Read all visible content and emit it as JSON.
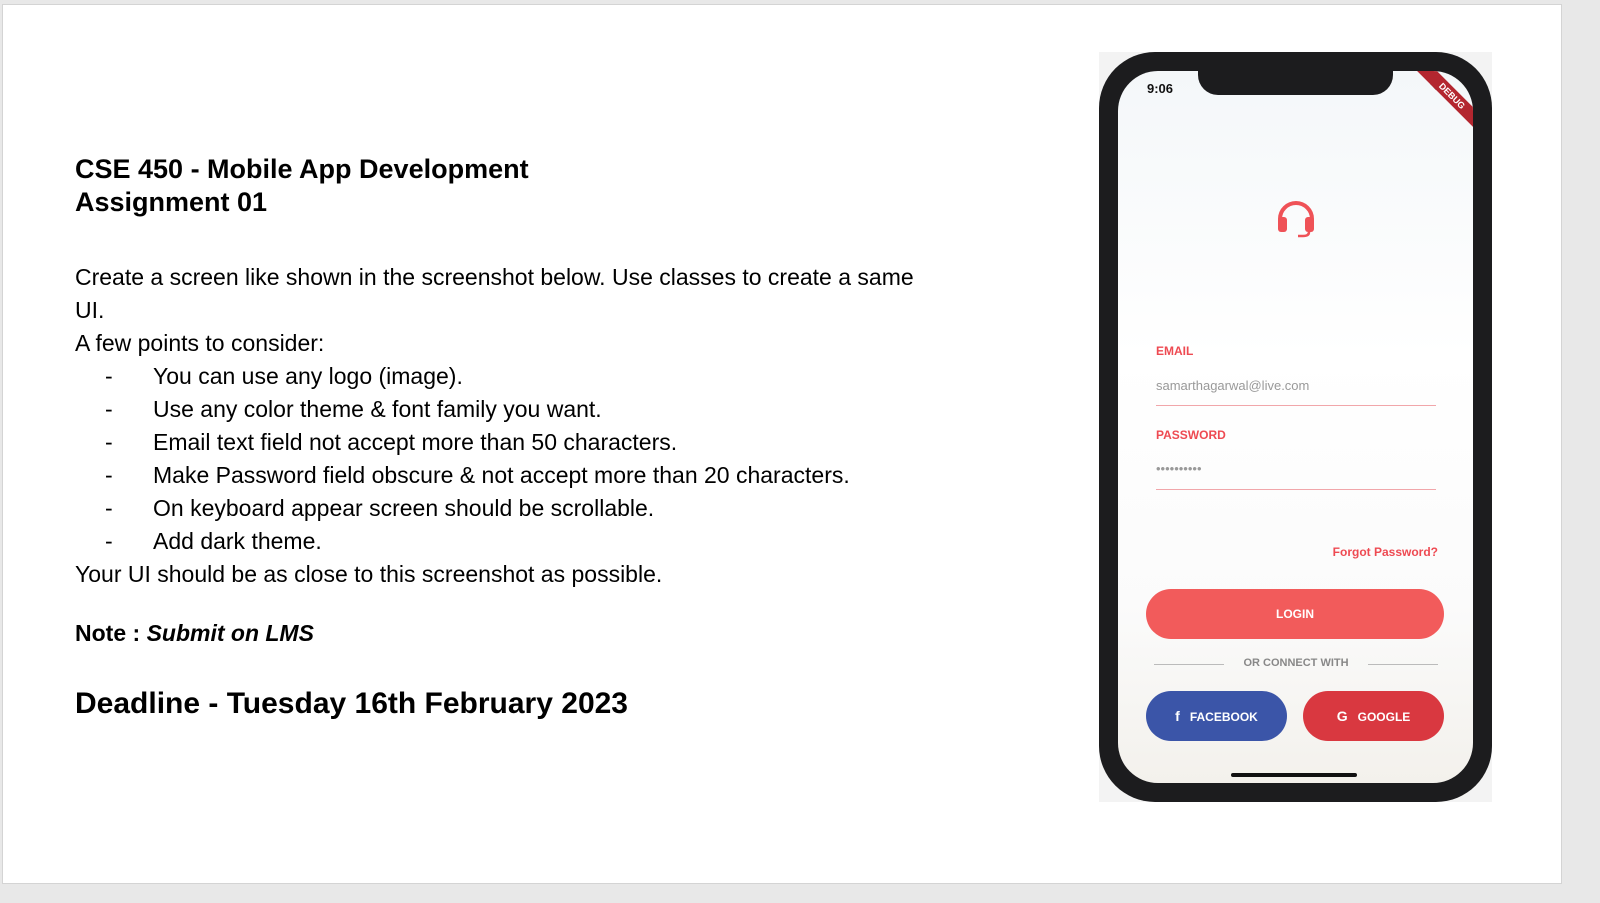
{
  "doc": {
    "title_line1": "CSE 450 - Mobile App Development",
    "title_line2": "Assignment 01",
    "intro": "Create a screen like shown in the screenshot below. Use classes to create a same UI.",
    "points_heading": "A few points to consider:",
    "bullet_marker": "-",
    "points": [
      "You can use any logo (image).",
      "Use any color theme & font family you want.",
      "Email text field not accept more than 50 characters.",
      "Make Password field obscure & not accept more than 20 characters.",
      "On keyboard appear screen should be scrollable.",
      "Add dark theme."
    ],
    "closing": "Your UI should be as close to this screenshot as possible.",
    "note_label": "Note :",
    "note_value": "Submit on LMS",
    "deadline": "Deadline - Tuesday 16th February 2023"
  },
  "phone": {
    "time": "9:06",
    "ribbon": "DEBUG",
    "logo_icon": "headphones-icon",
    "email_label": "EMAIL",
    "email_value": "samarthagarwal@live.com",
    "password_label": "PASSWORD",
    "password_value": "••••••••••",
    "forgot_label": "Forgot Password?",
    "login_label": "LOGIN",
    "divider_label": "OR CONNECT WITH",
    "facebook_label": "FACEBOOK",
    "google_label": "GOOGLE",
    "colors": {
      "accent": "#f25b5b",
      "facebook": "#3b55a8",
      "google": "#d93840"
    }
  }
}
